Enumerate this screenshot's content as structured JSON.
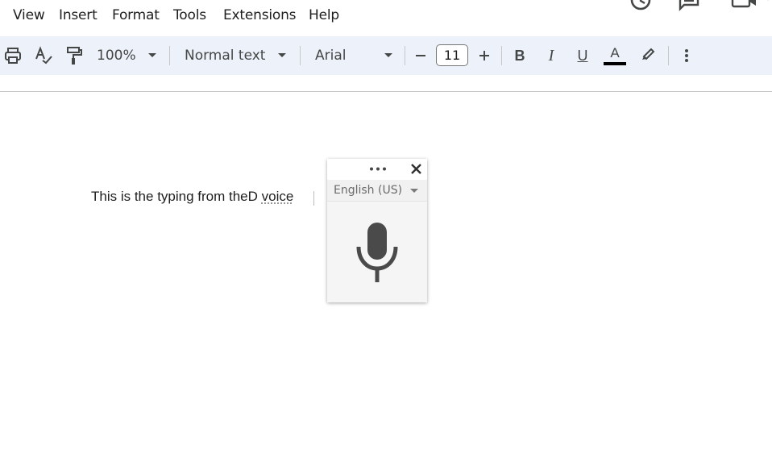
{
  "menu": {
    "items": [
      "View",
      "Insert",
      "Format",
      "Tools",
      "Extensions",
      "Help"
    ]
  },
  "toolbar": {
    "zoom": "100%",
    "style": "Normal text",
    "font": "Arial",
    "font_size": "11",
    "bold": "B",
    "italic": "I",
    "underline": "U",
    "text_color_letter": "A",
    "text_color": "#000000"
  },
  "document": {
    "text_before": "This is the typing from theD ",
    "text_underlined": "voice"
  },
  "voice_panel": {
    "language": "English (US)"
  }
}
